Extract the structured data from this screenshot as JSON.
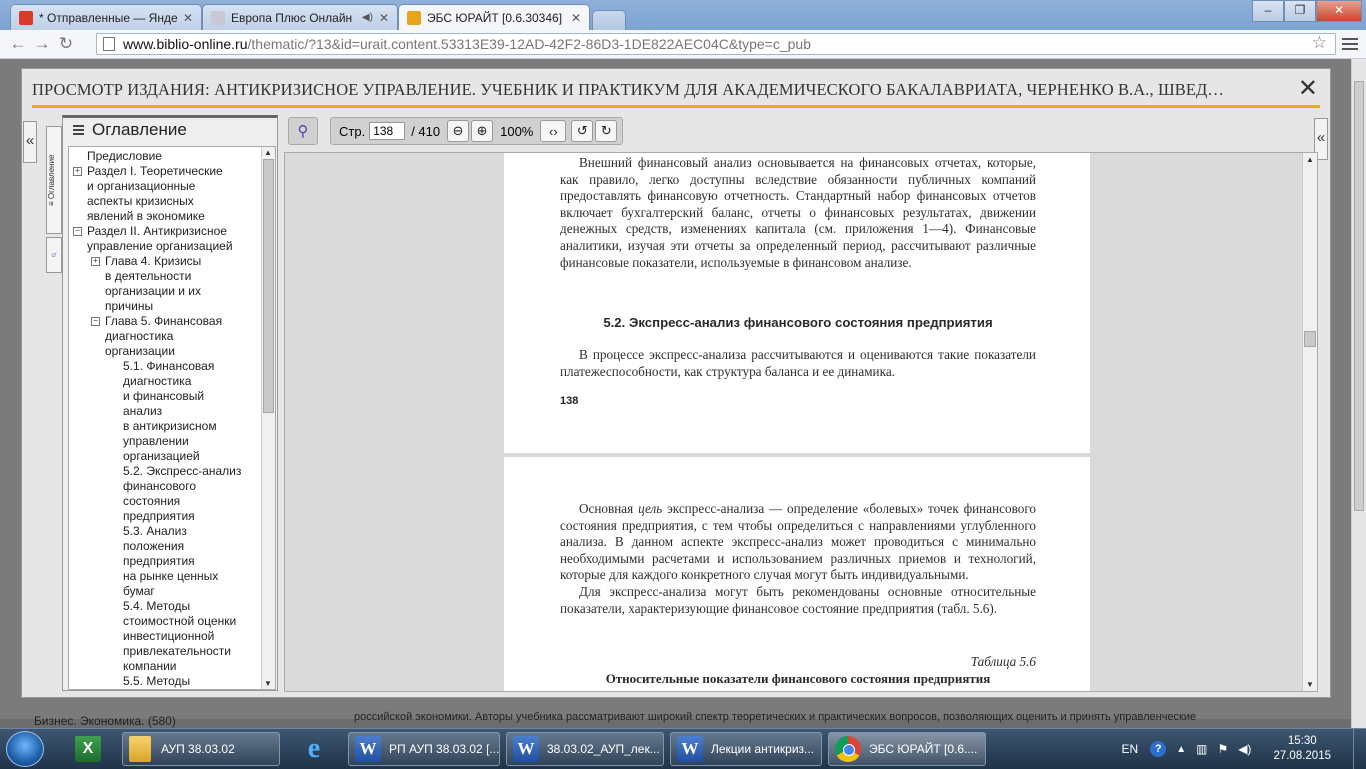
{
  "browser": {
    "tabs": [
      {
        "label": "* Отправленные — Янде",
        "fav_color": "#d93a2a"
      },
      {
        "label": "Европа Плюс Онлайн",
        "fav_color": "#c9c9d6",
        "audio_icon": "◀)"
      },
      {
        "label": "ЭБС ЮРАЙТ [0.6.30346]",
        "fav_color": "#e8a41c"
      }
    ],
    "url_host": "www.biblio-online.ru",
    "url_path": "/thematic/?13&id=urait.content.53313E39-12AD-42F2-86D3-1DE822AEC04C&type=c_pub"
  },
  "modal": {
    "title": "ПРОСМОТР ИЗДАНИЯ: АНТИКРИЗИСНОЕ УПРАВЛЕНИЕ. УЧЕБНИК И ПРАКТИКУМ ДЛЯ АКАДЕМИЧЕСКОГО БАКАЛАВРИАТА, ЧЕРНЕНКО В.А., ШВЕД…",
    "close": "✕",
    "collapse_left": "«",
    "collapse_right": "«",
    "side_tab_toc": "≡ Оглавление",
    "side_tab_search": "⌕"
  },
  "toc": {
    "heading": "Оглавление",
    "items": [
      {
        "text": "Предисловие",
        "lines": [
          "Предисловие"
        ],
        "level": 0,
        "toggle": ""
      },
      {
        "text": "Раздел I. Теоретические и организационные аспекты кризисных явлений в экономике",
        "lines": [
          "Раздел I. Теоретические",
          "и организационные",
          "аспекты кризисных",
          "явлений в экономике"
        ],
        "level": 0,
        "toggle": "+"
      },
      {
        "text": "Раздел II. Антикризисное управление организацией",
        "lines": [
          "Раздел II. Антикризисное",
          "управление организацией"
        ],
        "level": 0,
        "toggle": "−"
      },
      {
        "text": "Глава 4. Кризисы в деятельности организации и их причины",
        "lines": [
          "Глава 4. Кризисы",
          "в деятельности",
          "организации и их",
          "причины"
        ],
        "level": 1,
        "toggle": "+"
      },
      {
        "text": "Глава 5. Финансовая диагностика организации",
        "lines": [
          "Глава 5. Финансовая",
          "диагностика",
          "организации"
        ],
        "level": 1,
        "toggle": "−"
      },
      {
        "text": "5.1. Финансовая диагностика и финансовый анализ в антикризисном управлении организацией",
        "lines": [
          "5.1. Финансовая",
          "диагностика",
          "и финансовый",
          "анализ",
          "в антикризисном",
          "управлении",
          "организацией"
        ],
        "level": 2,
        "toggle": ""
      },
      {
        "text": "5.2. Экспресс-анализ финансового состояния предприятия",
        "lines": [
          "5.2. Экспресс-анализ",
          "финансового",
          "состояния",
          "предприятия"
        ],
        "level": 2,
        "toggle": ""
      },
      {
        "text": "5.3. Анализ положения предприятия на рынке ценных бумаг",
        "lines": [
          "5.3. Анализ",
          "положения",
          "предприятия",
          "на рынке ценных",
          "бумаг"
        ],
        "level": 2,
        "toggle": ""
      },
      {
        "text": "5.4. Методы стоимостной оценки инвестиционной привлекательности компании",
        "lines": [
          "5.4. Методы",
          "стоимостной оценки",
          "инвестиционной",
          "привлекательности",
          "компании"
        ],
        "level": 2,
        "toggle": ""
      },
      {
        "text": "5.5. Методы",
        "lines": [
          "5.5. Методы"
        ],
        "level": 2,
        "toggle": ""
      }
    ]
  },
  "viewer": {
    "search_icon": "magnifier-icon",
    "page_label": "Стр.",
    "page_value": "138",
    "page_total": "/ 410",
    "zoom_value": "100%"
  },
  "document": {
    "page1": {
      "para": "Внешний финансовый анализ основывается на финансовых отчетах, которые, как правило, легко доступны вследствие обязанности публичных компаний предоставлять финансовую отчетность. Стандартный набор финансовых отчетов включает бухгалтерский баланс, отчеты о финансовых результатах, движении денежных средств, изменениях капитала (см. приложения 1—4). Финансовые аналитики, изучая эти отчеты за определенный период, рассчитывают различные финансовые показатели, используемые в финансовом анализе.",
      "section": "5.2. Экспресс-анализ финансового состояния предприятия",
      "para2": "В процессе экспресс-анализа рассчитываются и оцениваются такие показатели платежеспособности, как структура баланса и ее динамика.",
      "number": "138"
    },
    "page2": {
      "para1_start": "Основная",
      "para1_em": "цель",
      "para1_rest": "экспресс-анализа — определение «болевых» точек финансового состояния предприятия, с тем чтобы определиться с направлениями углубленного анализа. В данном аспекте экспресс-анализ может проводиться с минимально необходимыми расчетами и использованием различных приемов и технологий, которые для каждого конкретного случая могут быть индивидуальными.",
      "para2": "Для экспресс-анализа могут быть рекомендованы основные относительные показатели, характеризующие финансовое состояние предприятия (табл. 5.6).",
      "table_label": "Таблица 5.6",
      "table_title": "Относительные показатели финансового состояния предприятия"
    }
  },
  "background": {
    "left_text": "Бизнес. Экономика. (580)",
    "right_text": "российской экономики. Авторы учебника рассматривают широкий спектр теоретических и практических вопросов, позволяющих оценить и принять управленческие"
  },
  "taskbar": {
    "items": [
      {
        "label": "АУП 38.03.02",
        "icon": "folder-icon"
      },
      {
        "label": "РП АУП 38.03.02 [...",
        "icon": "word-icon"
      },
      {
        "label": "38.03.02_АУП_лек...",
        "icon": "word-icon"
      },
      {
        "label": "Лекции антикриз...",
        "icon": "word-icon"
      },
      {
        "label": "ЭБС ЮРАЙТ [0.6....",
        "icon": "chrome-icon"
      }
    ],
    "lang": "EN",
    "time": "15:30",
    "date": "27.08.2015"
  }
}
